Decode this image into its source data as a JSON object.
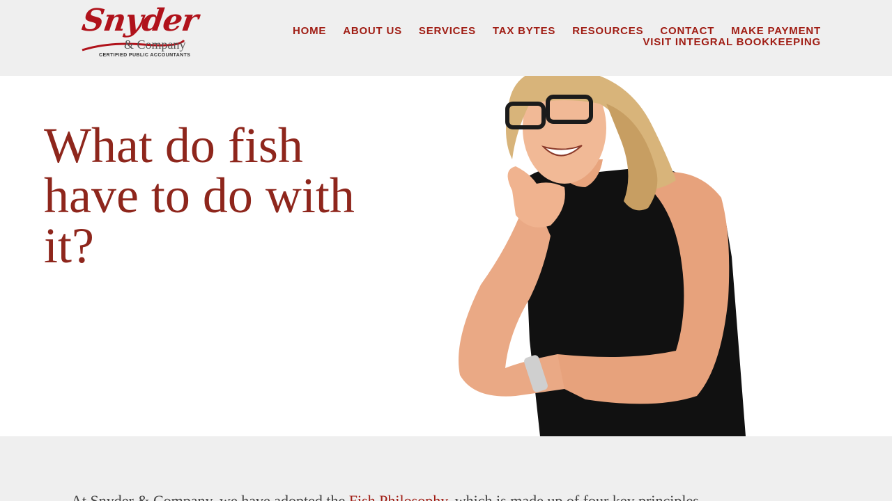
{
  "brand": {
    "name_script": "Snyder",
    "name_suffix": "& Company",
    "tagline": "CERTIFIED PUBLIC ACCOUNTANTS",
    "color": "#b0121b"
  },
  "nav": {
    "items": [
      {
        "label": "HOME"
      },
      {
        "label": "ABOUT US"
      },
      {
        "label": "SERVICES"
      },
      {
        "label": "TAX BYTES"
      },
      {
        "label": "RESOURCES"
      },
      {
        "label": "CONTACT"
      },
      {
        "label": "MAKE PAYMENT"
      }
    ],
    "second_row": {
      "label": "VISIT INTEGRAL BOOKKEEPING"
    },
    "color": "#a01d14"
  },
  "hero": {
    "title": "What do fish have to do with it?",
    "title_color": "#8e261c"
  },
  "intro": {
    "before_link": "At Snyder & Company, we have adopted the ",
    "link": "Fish Philosophy",
    "after_link": ", which is made up of four key principles"
  }
}
